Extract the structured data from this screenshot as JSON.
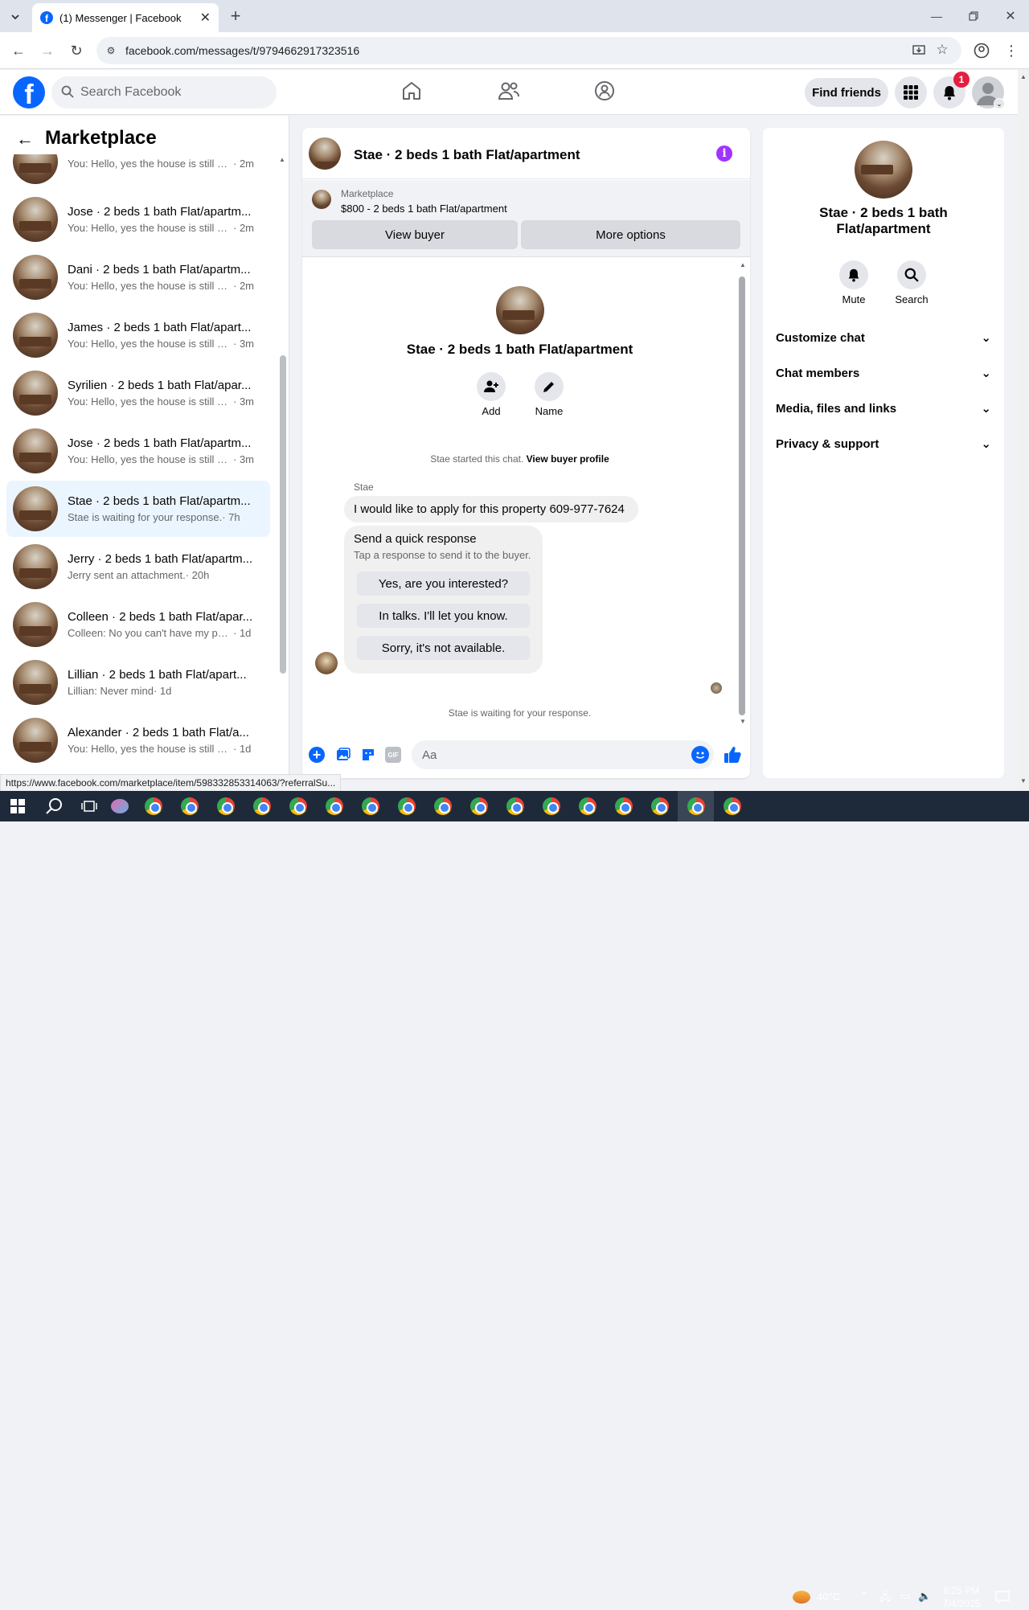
{
  "browser": {
    "tab_title": "(1) Messenger | Facebook",
    "url": "facebook.com/messages/t/9794662917323516",
    "status_url": "https://www.facebook.com/marketplace/item/598332853314063/?referralSu..."
  },
  "fb_header": {
    "search_placeholder": "Search Facebook",
    "find_friends": "Find friends",
    "notif_count": "1"
  },
  "left_panel": {
    "title": "Marketplace",
    "conversations": [
      {
        "name": "",
        "msg": "You: Hello, yes the house is still av...",
        "time": "· 2m"
      },
      {
        "name": "Jose · 2 beds 1 bath Flat/apartm...",
        "msg": "You: Hello, yes the house is still av...",
        "time": "· 2m"
      },
      {
        "name": "Dani · 2 beds 1 bath Flat/apartm...",
        "msg": "You: Hello, yes the house is still av...",
        "time": "· 2m"
      },
      {
        "name": "James · 2 beds 1 bath Flat/apart...",
        "msg": "You: Hello, yes the house is still av...",
        "time": "· 3m"
      },
      {
        "name": "Syrilien · 2 beds 1 bath Flat/apar...",
        "msg": "You: Hello, yes the house is still av...",
        "time": "· 3m"
      },
      {
        "name": "Jose · 2 beds 1 bath Flat/apartm...",
        "msg": "You: Hello, yes the house is still av...",
        "time": "· 3m"
      },
      {
        "name": "Stae · 2 beds 1 bath Flat/apartm...",
        "msg": "Stae is waiting for your response.",
        "time": "· 7h"
      },
      {
        "name": "Jerry · 2 beds 1 bath Flat/apartm...",
        "msg": "Jerry sent an attachment.",
        "time": "· 20h"
      },
      {
        "name": "Colleen · 2 beds 1 bath Flat/apar...",
        "msg": "Colleen: No you can't have my pho...",
        "time": "· 1d"
      },
      {
        "name": "Lillian · 2 beds 1 bath Flat/apart...",
        "msg": "Lillian: Never mind",
        "time": "· 1d"
      },
      {
        "name": "Alexander · 2 beds 1 bath Flat/a...",
        "msg": "You: Hello, yes the house is still ava...",
        "time": "· 1d"
      }
    ]
  },
  "chat": {
    "title": "Stae · 2 beds 1 bath Flat/apartment",
    "marketplace_label": "Marketplace",
    "listing": "$800 - 2 beds 1 bath Flat/apartment",
    "view_buyer": "View buyer",
    "more_options": "More options",
    "profile_name": "Stae · 2 beds 1 bath Flat/apartment",
    "add_label": "Add",
    "name_label": "Name",
    "started_text": "Stae started this chat.",
    "view_profile": "View buyer profile",
    "sender": "Stae",
    "message": "I would like to apply for this property 609-977-7624",
    "quick_title": "Send a quick response",
    "quick_sub": "Tap a response to send it to the buyer.",
    "quick_replies": [
      "Yes, are you interested?",
      "In talks. I'll let you know.",
      "Sorry, it's not available."
    ],
    "waiting": "Stae is waiting for your response.",
    "composer_placeholder": "Aa"
  },
  "right_panel": {
    "name_line1": "Stae · 2 beds 1 bath",
    "name_line2": "Flat/apartment",
    "mute": "Mute",
    "search": "Search",
    "sections": [
      "Customize chat",
      "Chat members",
      "Media, files and links",
      "Privacy & support"
    ]
  },
  "taskbar": {
    "weather": "40°C",
    "time": "6:25 PM",
    "date": "7/4/2025"
  },
  "colors": {
    "brand": "#0866ff",
    "accent_purple": "#a033ff",
    "notif": "#e41e3f"
  }
}
